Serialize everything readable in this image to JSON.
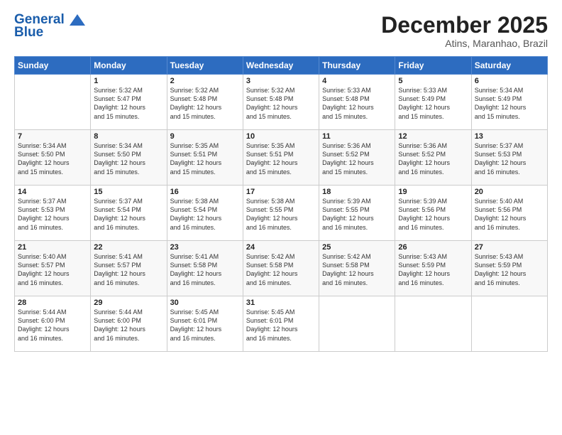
{
  "header": {
    "logo_line1": "General",
    "logo_line2": "Blue",
    "month_title": "December 2025",
    "location": "Atins, Maranhao, Brazil"
  },
  "days_of_week": [
    "Sunday",
    "Monday",
    "Tuesday",
    "Wednesday",
    "Thursday",
    "Friday",
    "Saturday"
  ],
  "weeks": [
    [
      {
        "day": "",
        "info": ""
      },
      {
        "day": "1",
        "info": "Sunrise: 5:32 AM\nSunset: 5:47 PM\nDaylight: 12 hours\nand 15 minutes."
      },
      {
        "day": "2",
        "info": "Sunrise: 5:32 AM\nSunset: 5:48 PM\nDaylight: 12 hours\nand 15 minutes."
      },
      {
        "day": "3",
        "info": "Sunrise: 5:32 AM\nSunset: 5:48 PM\nDaylight: 12 hours\nand 15 minutes."
      },
      {
        "day": "4",
        "info": "Sunrise: 5:33 AM\nSunset: 5:48 PM\nDaylight: 12 hours\nand 15 minutes."
      },
      {
        "day": "5",
        "info": "Sunrise: 5:33 AM\nSunset: 5:49 PM\nDaylight: 12 hours\nand 15 minutes."
      },
      {
        "day": "6",
        "info": "Sunrise: 5:34 AM\nSunset: 5:49 PM\nDaylight: 12 hours\nand 15 minutes."
      }
    ],
    [
      {
        "day": "7",
        "info": "Sunrise: 5:34 AM\nSunset: 5:50 PM\nDaylight: 12 hours\nand 15 minutes."
      },
      {
        "day": "8",
        "info": "Sunrise: 5:34 AM\nSunset: 5:50 PM\nDaylight: 12 hours\nand 15 minutes."
      },
      {
        "day": "9",
        "info": "Sunrise: 5:35 AM\nSunset: 5:51 PM\nDaylight: 12 hours\nand 15 minutes."
      },
      {
        "day": "10",
        "info": "Sunrise: 5:35 AM\nSunset: 5:51 PM\nDaylight: 12 hours\nand 15 minutes."
      },
      {
        "day": "11",
        "info": "Sunrise: 5:36 AM\nSunset: 5:52 PM\nDaylight: 12 hours\nand 15 minutes."
      },
      {
        "day": "12",
        "info": "Sunrise: 5:36 AM\nSunset: 5:52 PM\nDaylight: 12 hours\nand 16 minutes."
      },
      {
        "day": "13",
        "info": "Sunrise: 5:37 AM\nSunset: 5:53 PM\nDaylight: 12 hours\nand 16 minutes."
      }
    ],
    [
      {
        "day": "14",
        "info": "Sunrise: 5:37 AM\nSunset: 5:53 PM\nDaylight: 12 hours\nand 16 minutes."
      },
      {
        "day": "15",
        "info": "Sunrise: 5:37 AM\nSunset: 5:54 PM\nDaylight: 12 hours\nand 16 minutes."
      },
      {
        "day": "16",
        "info": "Sunrise: 5:38 AM\nSunset: 5:54 PM\nDaylight: 12 hours\nand 16 minutes."
      },
      {
        "day": "17",
        "info": "Sunrise: 5:38 AM\nSunset: 5:55 PM\nDaylight: 12 hours\nand 16 minutes."
      },
      {
        "day": "18",
        "info": "Sunrise: 5:39 AM\nSunset: 5:55 PM\nDaylight: 12 hours\nand 16 minutes."
      },
      {
        "day": "19",
        "info": "Sunrise: 5:39 AM\nSunset: 5:56 PM\nDaylight: 12 hours\nand 16 minutes."
      },
      {
        "day": "20",
        "info": "Sunrise: 5:40 AM\nSunset: 5:56 PM\nDaylight: 12 hours\nand 16 minutes."
      }
    ],
    [
      {
        "day": "21",
        "info": "Sunrise: 5:40 AM\nSunset: 5:57 PM\nDaylight: 12 hours\nand 16 minutes."
      },
      {
        "day": "22",
        "info": "Sunrise: 5:41 AM\nSunset: 5:57 PM\nDaylight: 12 hours\nand 16 minutes."
      },
      {
        "day": "23",
        "info": "Sunrise: 5:41 AM\nSunset: 5:58 PM\nDaylight: 12 hours\nand 16 minutes."
      },
      {
        "day": "24",
        "info": "Sunrise: 5:42 AM\nSunset: 5:58 PM\nDaylight: 12 hours\nand 16 minutes."
      },
      {
        "day": "25",
        "info": "Sunrise: 5:42 AM\nSunset: 5:58 PM\nDaylight: 12 hours\nand 16 minutes."
      },
      {
        "day": "26",
        "info": "Sunrise: 5:43 AM\nSunset: 5:59 PM\nDaylight: 12 hours\nand 16 minutes."
      },
      {
        "day": "27",
        "info": "Sunrise: 5:43 AM\nSunset: 5:59 PM\nDaylight: 12 hours\nand 16 minutes."
      }
    ],
    [
      {
        "day": "28",
        "info": "Sunrise: 5:44 AM\nSunset: 6:00 PM\nDaylight: 12 hours\nand 16 minutes."
      },
      {
        "day": "29",
        "info": "Sunrise: 5:44 AM\nSunset: 6:00 PM\nDaylight: 12 hours\nand 16 minutes."
      },
      {
        "day": "30",
        "info": "Sunrise: 5:45 AM\nSunset: 6:01 PM\nDaylight: 12 hours\nand 16 minutes."
      },
      {
        "day": "31",
        "info": "Sunrise: 5:45 AM\nSunset: 6:01 PM\nDaylight: 12 hours\nand 16 minutes."
      },
      {
        "day": "",
        "info": ""
      },
      {
        "day": "",
        "info": ""
      },
      {
        "day": "",
        "info": ""
      }
    ]
  ]
}
